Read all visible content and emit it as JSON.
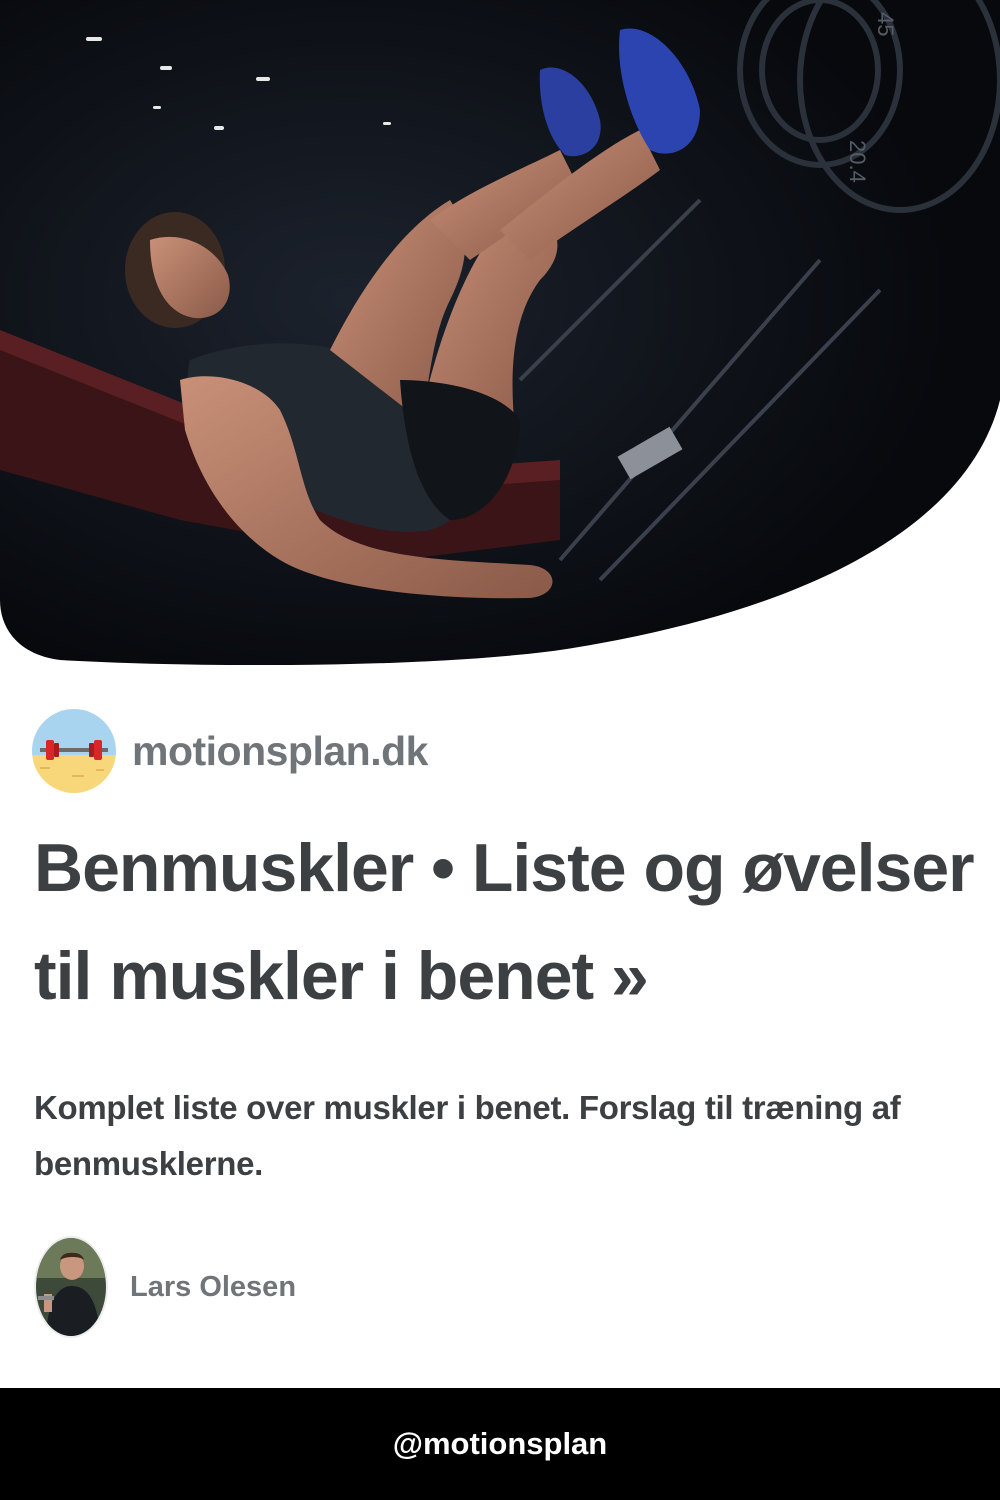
{
  "hero": {
    "image_alt": "Woman training legs in a leg press machine in a dark gym",
    "plate_labels": [
      "45",
      "20.4"
    ]
  },
  "site": {
    "name": "motionsplan.dk",
    "logo_icon": "barbell-icon"
  },
  "article": {
    "title": "Benmuskler • Liste og øvelser til muskler i benet »",
    "description": "Komplet liste over muskler i benet. Forslag til træning af benmusklerne."
  },
  "author": {
    "name": "Lars Olesen",
    "avatar_icon": "person-photo-icon"
  },
  "footer": {
    "handle": "@motionsplan"
  },
  "colors": {
    "text_dark": "#3c4043",
    "text_muted": "#70757a",
    "hero_bg": "#0f1218",
    "footer_bg": "#000000"
  }
}
